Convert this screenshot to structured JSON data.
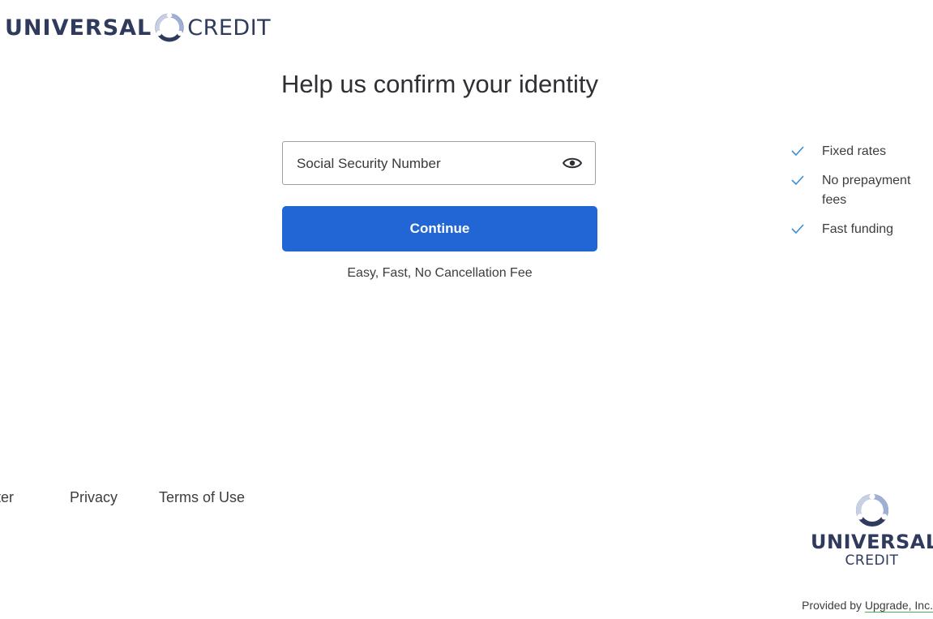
{
  "header": {
    "logo_bold": "UNIVERSAL",
    "logo_light": "CREDIT"
  },
  "main": {
    "title": "Help us confirm your identity",
    "ssn_placeholder": "Social Security Number",
    "continue_label": "Continue",
    "tagline": "Easy, Fast, No Cancellation Fee"
  },
  "features": [
    "Fixed rates",
    "No prepayment fees",
    "Fast funding"
  ],
  "footer": {
    "links": [
      "enter",
      "Privacy",
      "Terms of Use"
    ],
    "logo_bold": "UNIVERSAL",
    "logo_light": "CREDIT",
    "provided_prefix": "Provided by ",
    "provided_link": "Upgrade, Inc."
  },
  "colors": {
    "primary_button": "#2166d4",
    "brand_navy": "#2f3a5c",
    "check": "#3d8fd1",
    "link_underline": "#4caf50"
  }
}
